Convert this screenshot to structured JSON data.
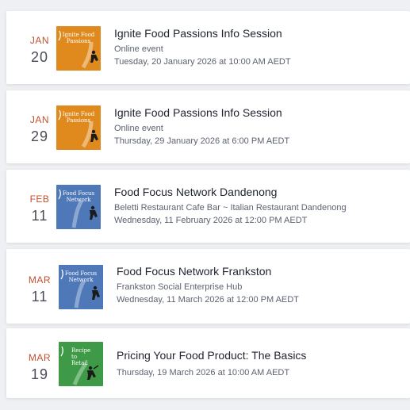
{
  "events": [
    {
      "month": "JAN",
      "day": "20",
      "thumb_text": "Ignite Food Passions",
      "thumb_color": "#e08a1e",
      "thumb_icon": "person-icon",
      "title": "Ignite Food Passions Info Session",
      "location": "Online event",
      "datetime": "Tuesday, 20 January 2026 at 10:00 AM AEDT"
    },
    {
      "month": "JAN",
      "day": "29",
      "thumb_text": "Ignite Food Passions",
      "thumb_color": "#e08a1e",
      "thumb_icon": "person-icon",
      "title": "Ignite Food Passions Info Session",
      "location": "Online event",
      "datetime": "Thursday, 29 January 2026 at 6:00 PM AEDT"
    },
    {
      "month": "FEB",
      "day": "11",
      "thumb_text": "Food Focus Network",
      "thumb_color": "#4f78b8",
      "thumb_icon": "person-icon",
      "title": "Food Focus Network Dandenong",
      "location": "Beletti Restaurant Cafe Bar ~ Italian Restaurant Dandenong",
      "datetime": "Wednesday, 11 February 2026 at 12:00 PM AEDT"
    },
    {
      "month": "MAR",
      "day": "11",
      "thumb_text": "Food Focus Network",
      "thumb_color": "#4f78b8",
      "thumb_icon": "person-icon",
      "title": "Food Focus Network Frankston",
      "location": "Frankston Social Enterprise Hub",
      "datetime": "Wednesday, 11 March 2026 at 12:00 PM AEDT"
    },
    {
      "month": "MAR",
      "day": "19",
      "thumb_text": "Recipe to Retail",
      "thumb_color": "#3e9a46",
      "thumb_icon": "person-icon",
      "title": "Pricing Your Food Product: The Basics",
      "location": "",
      "datetime": "Thursday, 19 March 2026 at 10:00 AM AEDT"
    }
  ],
  "colors": {
    "month": "#c24f2c",
    "day": "#4a4d57",
    "title": "#1f2330",
    "meta": "#5c6270"
  }
}
